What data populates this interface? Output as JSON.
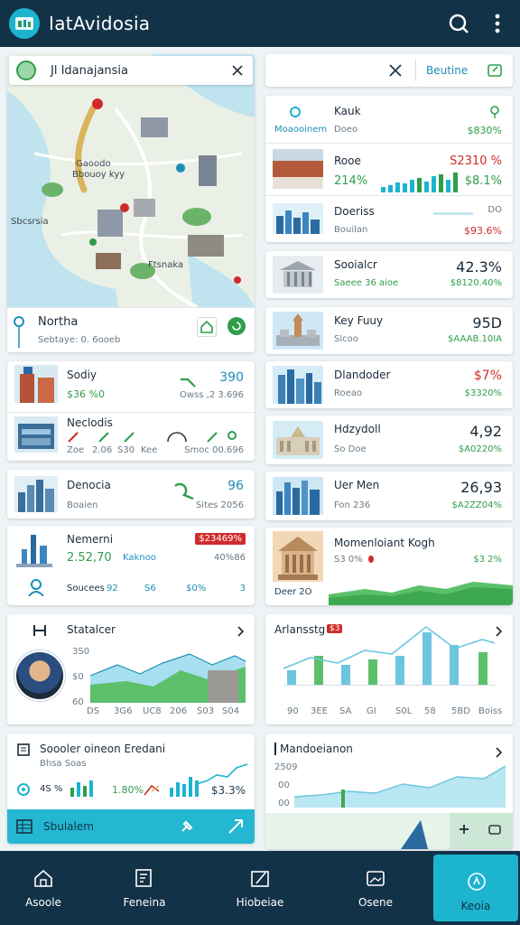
{
  "app": {
    "title": "IatAvidosia"
  },
  "map_card": {
    "search_text": "Jl Idanajansia",
    "map_labels": [
      "Gaoodo",
      "Bbouoy kyy",
      "Ftsnaka",
      "Sbcsrsia"
    ],
    "location_title": "Northa",
    "location_sub": "Sebtaye: 0. 6ooeb"
  },
  "right_search": {
    "button_label": "Beutine"
  },
  "list_right": [
    {
      "title": "Kauk",
      "sub": "Moaooinem",
      "sub2": "Doeo",
      "value": "",
      "value2": "$830%"
    },
    {
      "title": "Rooe",
      "sub": "214%",
      "value": "S2310 %",
      "value2": "$8.1%"
    },
    {
      "title": "Doeriss",
      "sub": "Bouilan",
      "value": "DO",
      "value2": "$93.6%"
    },
    {
      "title": "Sooialcr",
      "sub": "Saeee 36 aioe",
      "value": "42.3%",
      "value2": "$8120.40%"
    },
    {
      "title": "Key Fuuy",
      "sub": "Sicoo",
      "value": "95D",
      "value2": "$AAAB.10IA"
    },
    {
      "title": "Dlandoder",
      "sub": "Roeao",
      "value": "$7%",
      "value2": "$3320%"
    },
    {
      "title": "Hdzydoll",
      "sub": "So Doe",
      "value": "4,92",
      "value2": "$A0220%"
    },
    {
      "title": "Uer Men",
      "sub": "Fon 236",
      "value": "26,93",
      "value2": "$A2ZZ04%"
    }
  ],
  "list_left": [
    {
      "title": "Sodiy",
      "sub": "$36 %0",
      "value": "390",
      "value2": "Owss ,2 3.696"
    },
    {
      "title": "Neclodis",
      "sub": "Zoe",
      "extra": [
        "2.06",
        "S30",
        "Kee",
        "Smoc 00.696"
      ]
    },
    {
      "title": "Denocia",
      "sub": "Boaien",
      "value": "96",
      "value2": "Sites 2056"
    }
  ],
  "metrics_card": {
    "title": "Nemerni",
    "badge": "$23469%",
    "main": "2.52,70",
    "main_label": "Kaknoo",
    "right": "40%86",
    "row": [
      "Soucees",
      "92",
      "S6",
      "$0%",
      "3"
    ]
  },
  "statalner": {
    "title": "Statalcer",
    "y_ticks": [
      "3S0",
      "$0",
      "60"
    ],
    "x_ticks": [
      "DS",
      "3G6",
      "UC8",
      "206",
      "S03",
      "S04"
    ]
  },
  "monument": {
    "title": "Momenloiant Kogh",
    "sub": "S3 0%",
    "badge": "$3 2%",
    "footer": "Deer 2O"
  },
  "analysis": {
    "title": "Arlansstg",
    "badge": "$3",
    "x_ticks": [
      "90",
      "3EE",
      "SA",
      "GI",
      "S0L",
      "58",
      "5BD",
      "Boiss"
    ]
  },
  "summary": {
    "title": "Soooler oineon Eredani",
    "sub": "Bhsa Soas",
    "stats": [
      "4S %",
      "1.80%"
    ],
    "value": "$3.3%",
    "footer": "Sbulalem"
  },
  "mlandon": {
    "title": "Mandoeianon",
    "y_ticks": [
      "2509",
      "00",
      "00"
    ]
  },
  "nav": [
    {
      "label": "Asoole"
    },
    {
      "label": "Feneina"
    },
    {
      "label": "Hiobeiae"
    },
    {
      "label": "Osene"
    },
    {
      "label": "Keoia"
    }
  ],
  "colors": {
    "topbar": "#123248",
    "accent": "#1db4cf",
    "green": "#2f9d4c",
    "red": "#cf2b2b",
    "chart_green": "#5cc06b",
    "chart_blue": "#6cc6e0"
  }
}
